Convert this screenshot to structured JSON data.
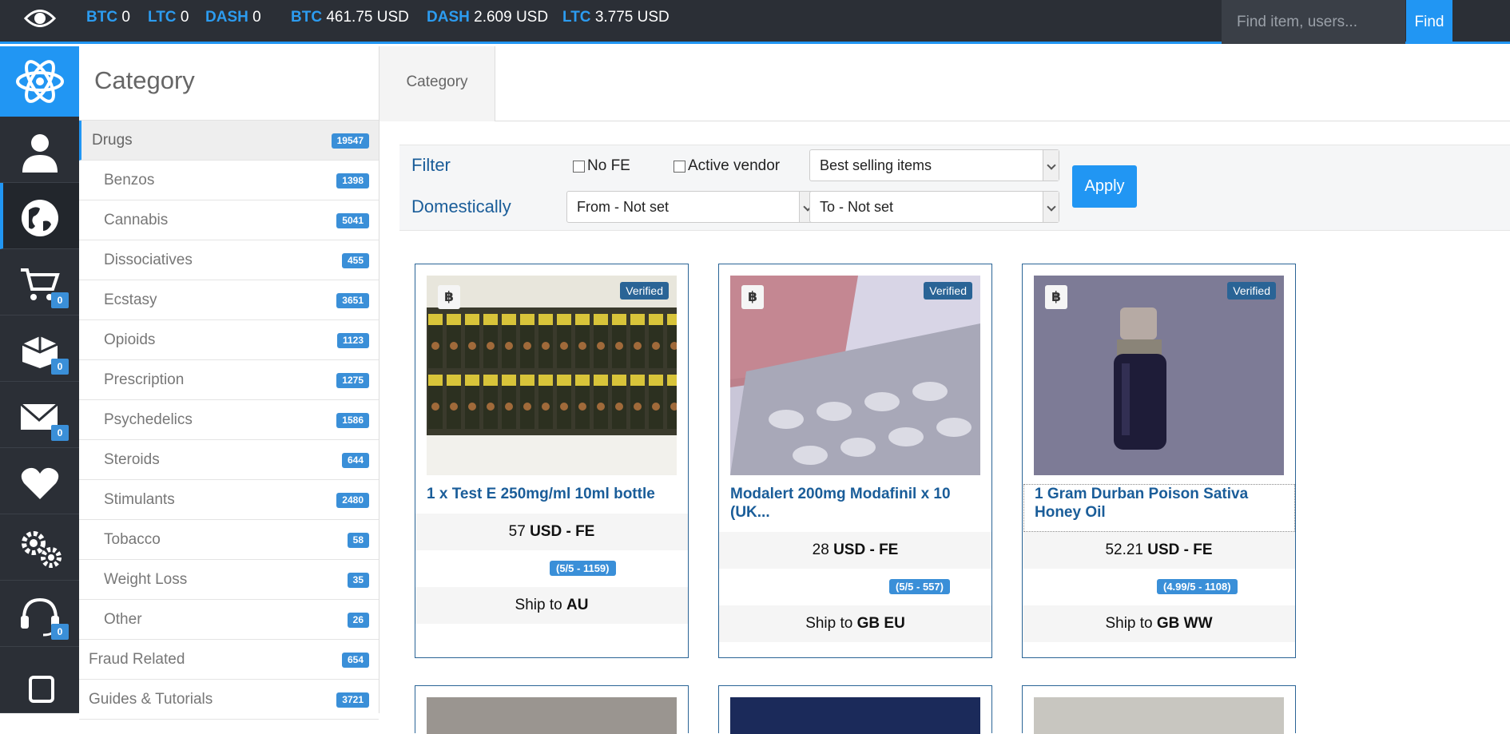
{
  "ticker": {
    "balances": [
      {
        "coin": "BTC",
        "value": "0"
      },
      {
        "coin": "LTC",
        "value": "0"
      },
      {
        "coin": "DASH",
        "value": "0"
      }
    ],
    "rates": [
      {
        "coin": "BTC",
        "value": "461.75 USD"
      },
      {
        "coin": "DASH",
        "value": "2.609 USD"
      },
      {
        "coin": "LTC",
        "value": "3.775 USD"
      }
    ]
  },
  "search": {
    "placeholder": "Find item, users...",
    "button": "Find"
  },
  "rail": {
    "badges": {
      "cart": "0",
      "orders": "0",
      "messages": "0",
      "support": "0"
    }
  },
  "category": {
    "title": "Category",
    "items": [
      {
        "label": "Drugs",
        "count": "19547"
      },
      {
        "label": "Benzos",
        "count": "1398"
      },
      {
        "label": "Cannabis",
        "count": "5041"
      },
      {
        "label": "Dissociatives",
        "count": "455"
      },
      {
        "label": "Ecstasy",
        "count": "3651"
      },
      {
        "label": "Opioids",
        "count": "1123"
      },
      {
        "label": "Prescription",
        "count": "1275"
      },
      {
        "label": "Psychedelics",
        "count": "1586"
      },
      {
        "label": "Steroids",
        "count": "644"
      },
      {
        "label": "Stimulants",
        "count": "2480"
      },
      {
        "label": "Tobacco",
        "count": "58"
      },
      {
        "label": "Weight Loss",
        "count": "35"
      },
      {
        "label": "Other",
        "count": "26"
      },
      {
        "label": "Fraud Related",
        "count": "654"
      },
      {
        "label": "Guides & Tutorials",
        "count": "3721"
      }
    ]
  },
  "tabs": {
    "category": "Category"
  },
  "filter": {
    "filter_label": "Filter",
    "domestic_label": "Domestically",
    "no_fe": "No FE",
    "active_vendor": "Active vendor",
    "sort_value": "Best selling items",
    "from_value": "From - Not set",
    "to_value": "To - Not set",
    "apply": "Apply"
  },
  "listings": [
    {
      "coin": "฿",
      "badge": "Verified",
      "title": "1 x Test E 250mg/ml 10ml bottle",
      "price": "57",
      "price_unit": "USD - FE",
      "rating": "(5/5 - 1159)",
      "ship_prefix": "Ship to",
      "ship_to": "AU"
    },
    {
      "coin": "฿",
      "badge": "Verified",
      "title": "Modalert 200mg Modafinil x 10 (UK...",
      "price": "28",
      "price_unit": "USD - FE",
      "rating": "(5/5 - 557)",
      "ship_prefix": "Ship to",
      "ship_to": "GB EU"
    },
    {
      "coin": "฿",
      "badge": "Verified",
      "title": "1 Gram Durban Poison Sativa Honey Oil",
      "price": "52.21",
      "price_unit": "USD - FE",
      "rating": "(4.99/5 - 1108)",
      "ship_prefix": "Ship to",
      "ship_to": "GB WW"
    }
  ],
  "colors": {
    "accent": "#2196f3",
    "dark": "#2b2f36",
    "link": "#1a5d99",
    "badge": "#3a8fd8"
  }
}
